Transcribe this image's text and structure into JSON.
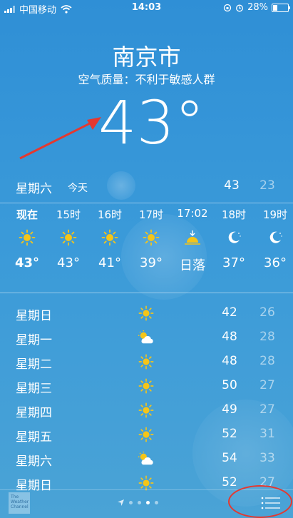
{
  "status_bar": {
    "carrier": "中国移动",
    "time": "14:03",
    "battery": "28%",
    "battery_level": 0.28
  },
  "location": {
    "city": "南京市",
    "air_quality": "空气质量：不利于敏感人群",
    "current_temp": "43°"
  },
  "today": {
    "day": "星期六",
    "tag": "今天",
    "high": "43",
    "low": "23"
  },
  "hourly": [
    {
      "time": "现在",
      "icon": "sun-icon",
      "value": "43°"
    },
    {
      "time": "15时",
      "icon": "sun-icon",
      "value": "43°"
    },
    {
      "time": "16时",
      "icon": "sun-icon",
      "value": "41°"
    },
    {
      "time": "17时",
      "icon": "sun-icon",
      "value": "39°"
    },
    {
      "time": "17:02",
      "icon": "sunset-icon",
      "value": "日落"
    },
    {
      "time": "18时",
      "icon": "moon-icon",
      "value": "37°"
    },
    {
      "time": "19时",
      "icon": "moon-icon",
      "value": "36°"
    }
  ],
  "daily": [
    {
      "day": "星期日",
      "icon": "sun-icon",
      "high": "42",
      "low": "26"
    },
    {
      "day": "星期一",
      "icon": "partly-cloudy-icon",
      "high": "48",
      "low": "28"
    },
    {
      "day": "星期二",
      "icon": "sun-icon",
      "high": "48",
      "low": "28"
    },
    {
      "day": "星期三",
      "icon": "sun-icon",
      "high": "50",
      "low": "27"
    },
    {
      "day": "星期四",
      "icon": "sun-icon",
      "high": "49",
      "low": "27"
    },
    {
      "day": "星期五",
      "icon": "sun-icon",
      "high": "52",
      "low": "31"
    },
    {
      "day": "星期六",
      "icon": "partly-cloudy-icon",
      "high": "54",
      "low": "33"
    },
    {
      "day": "星期日",
      "icon": "sun-icon",
      "high": "52",
      "low": "27"
    }
  ],
  "bottom_bar": {
    "logo_text": "The Weather Channel",
    "page_count": 4,
    "active_page": 2
  },
  "colors": {
    "background": "#3a9ad9",
    "sun": "#f5c518",
    "annotation": "#e5382f"
  }
}
